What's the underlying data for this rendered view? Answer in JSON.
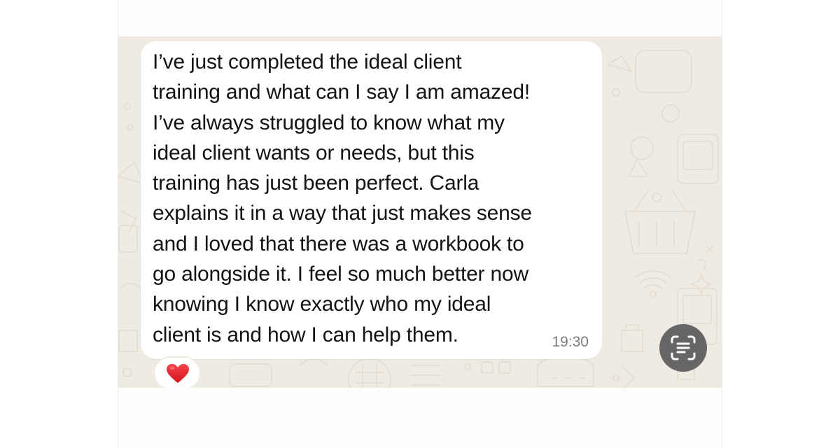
{
  "message": {
    "lines": [
      "I’ve just completed the ideal client",
      "training and what can I say I am amazed!",
      "I’ve always struggled to know what my",
      "ideal client wants or needs, but this",
      "training has just been perfect. Carla",
      "explains it in a way that just makes sense",
      "and I loved that there was a workbook to",
      "go alongside it. I feel so much better now",
      "knowing I know exactly who my ideal",
      "client is and how I can help them."
    ],
    "time": "19:30",
    "reaction": "heart-emoji"
  },
  "icons": {
    "live_text": "text-scan-icon",
    "reaction": "red-heart-icon"
  },
  "colors": {
    "chat_background": "#efeae2",
    "bubble": "#ffffff",
    "text": "#141414",
    "timestamp": "#7c7c7c",
    "heart": "#e0202a",
    "live_text_button": "#5f5f5f"
  }
}
